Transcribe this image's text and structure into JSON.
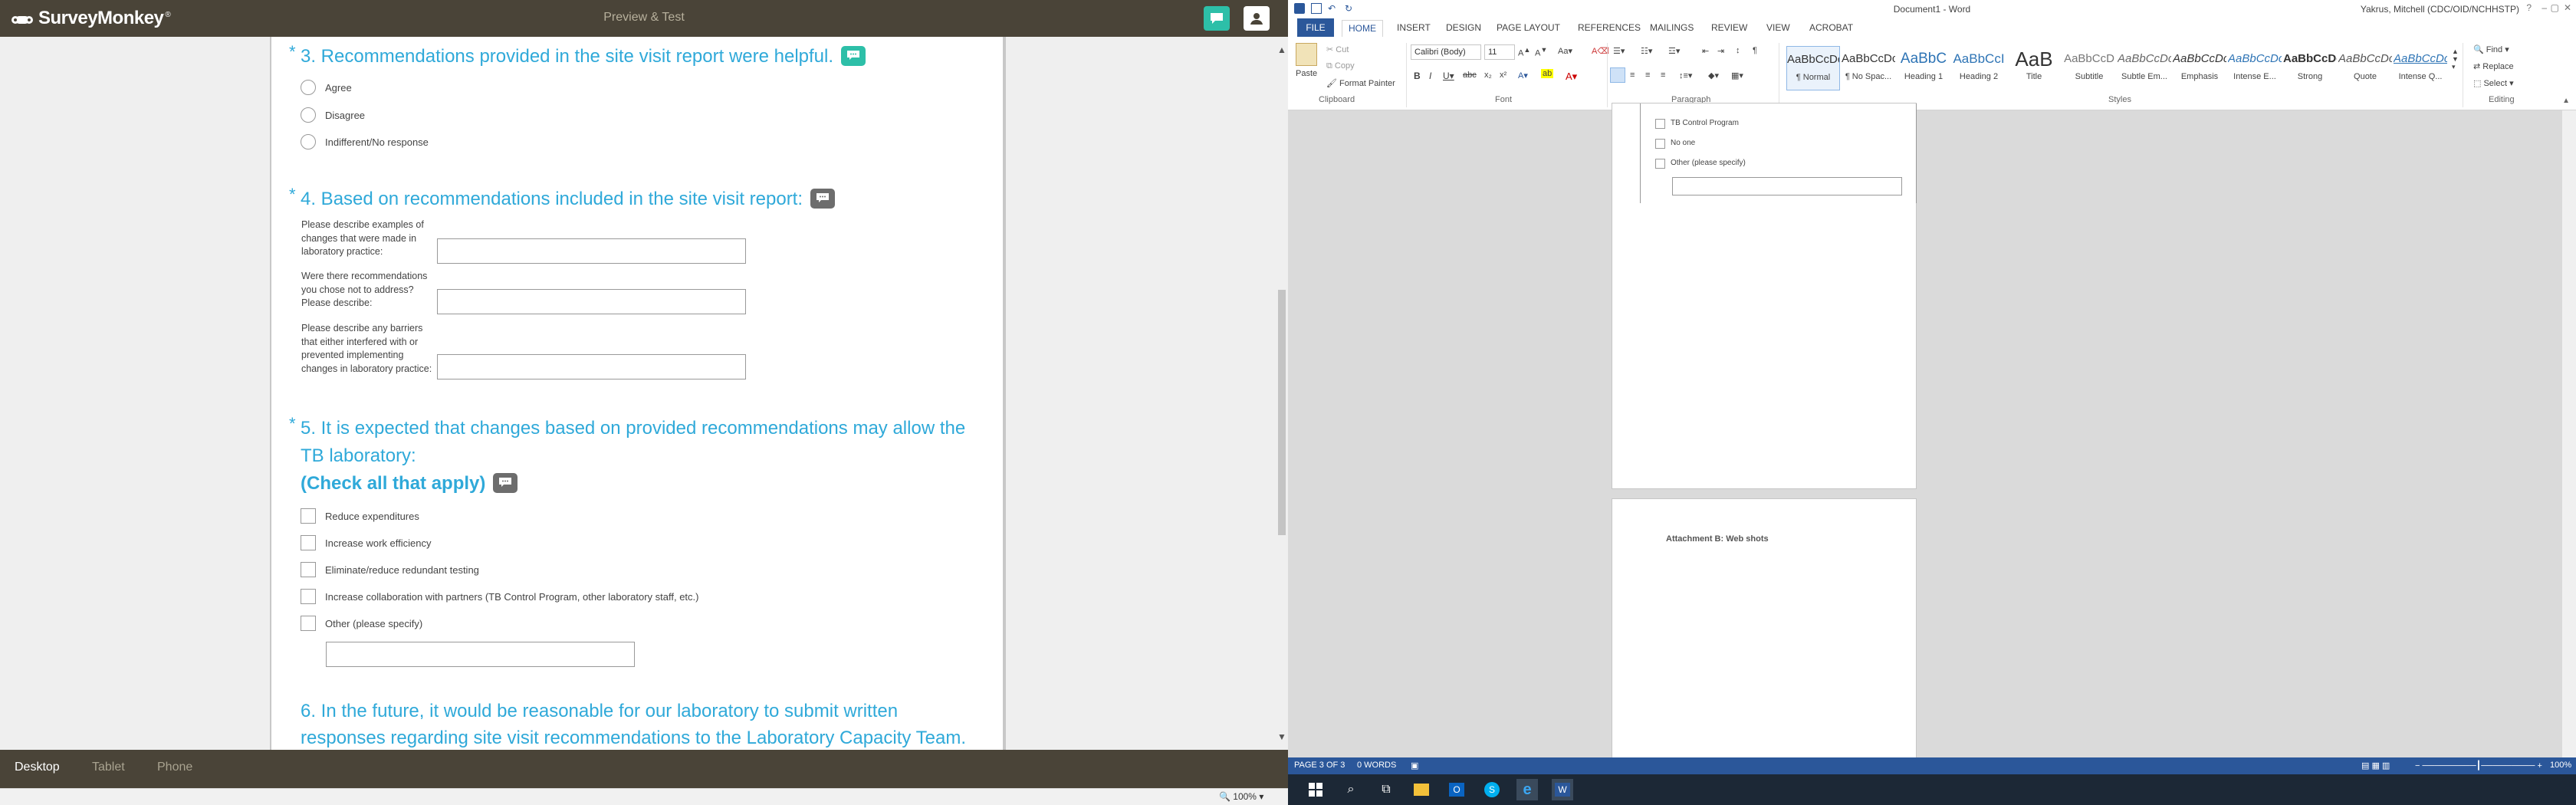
{
  "survey": {
    "logo": "SurveyMonkey",
    "header_title": "Preview & Test",
    "questions": {
      "q3": {
        "title": "3. Recommendations provided in the site visit report were helpful.",
        "options": [
          "Agree",
          "Disagree",
          "Indifferent/No response"
        ]
      },
      "q4": {
        "title": "4. Based on recommendations included in the site visit report:",
        "fields": [
          "Please describe examples of changes that were made in laboratory practice:",
          "Were there recommendations you chose not to address? Please describe:",
          "Please describe any barriers that either interfered with or prevented implementing changes in laboratory practice:"
        ]
      },
      "q5": {
        "title": "5. It is expected that changes based on provided recommendations may allow the TB laboratory:",
        "subtitle": "(Check all that apply)",
        "options": [
          "Reduce expenditures",
          "Increase work efficiency",
          "Eliminate/reduce redundant testing",
          "Increase collaboration with partners (TB Control Program, other laboratory staff, etc.)",
          "Other (please specify)"
        ]
      },
      "q6": {
        "title": "6. In the future, it would be reasonable for our laboratory to submit written responses regarding site visit recommendations to the Laboratory Capacity Team."
      }
    },
    "device_tabs": [
      "Desktop",
      "Tablet",
      "Phone"
    ],
    "zoom": "100%"
  },
  "word": {
    "window_title": "Document1 - Word",
    "user": "Yakrus, Mitchell (CDC/OID/NCHHSTP)",
    "ribbon_tabs": [
      "FILE",
      "HOME",
      "INSERT",
      "DESIGN",
      "PAGE LAYOUT",
      "REFERENCES",
      "MAILINGS",
      "REVIEW",
      "VIEW",
      "ACROBAT"
    ],
    "clipboard": {
      "paste": "Paste",
      "cut": "Cut",
      "copy": "Copy",
      "format_painter": "Format Painter",
      "group": "Clipboard"
    },
    "font": {
      "name": "Calibri (Body)",
      "size": "11",
      "group": "Font"
    },
    "paragraph_group": "Paragraph",
    "styles_group": "Styles",
    "styles": [
      {
        "preview": "AaBbCcDc",
        "name": "¶ Normal"
      },
      {
        "preview": "AaBbCcDc",
        "name": "¶ No Spac..."
      },
      {
        "preview": "AaBbC",
        "name": "Heading 1"
      },
      {
        "preview": "AaBbCcI",
        "name": "Heading 2"
      },
      {
        "preview": "AaB",
        "name": "Title"
      },
      {
        "preview": "AaBbCcD",
        "name": "Subtitle"
      },
      {
        "preview": "AaBbCcDc",
        "name": "Subtle Em..."
      },
      {
        "preview": "AaBbCcDc",
        "name": "Emphasis"
      },
      {
        "preview": "AaBbCcDc",
        "name": "Intense E..."
      },
      {
        "preview": "AaBbCcDc",
        "name": "Strong"
      },
      {
        "preview": "AaBbCcDc",
        "name": "Quote"
      },
      {
        "preview": "AaBbCcDc",
        "name": "Intense Q..."
      }
    ],
    "editing": {
      "find": "Find",
      "replace": "Replace",
      "select": "Select",
      "group": "Editing"
    },
    "doc": {
      "items": [
        "TB Control Program",
        "No one",
        "Other (please specify)"
      ],
      "attachment": "Attachment B: Web shots"
    },
    "status": {
      "page": "PAGE 3 OF 3",
      "words": "0 WORDS",
      "zoom": "100%"
    }
  },
  "colors": {
    "sm_accent": "#2fa9d9",
    "sm_bar": "#4a4438",
    "sm_teal": "#2dbfa8",
    "word_blue": "#2b579a",
    "taskbar": "#1c2836"
  }
}
